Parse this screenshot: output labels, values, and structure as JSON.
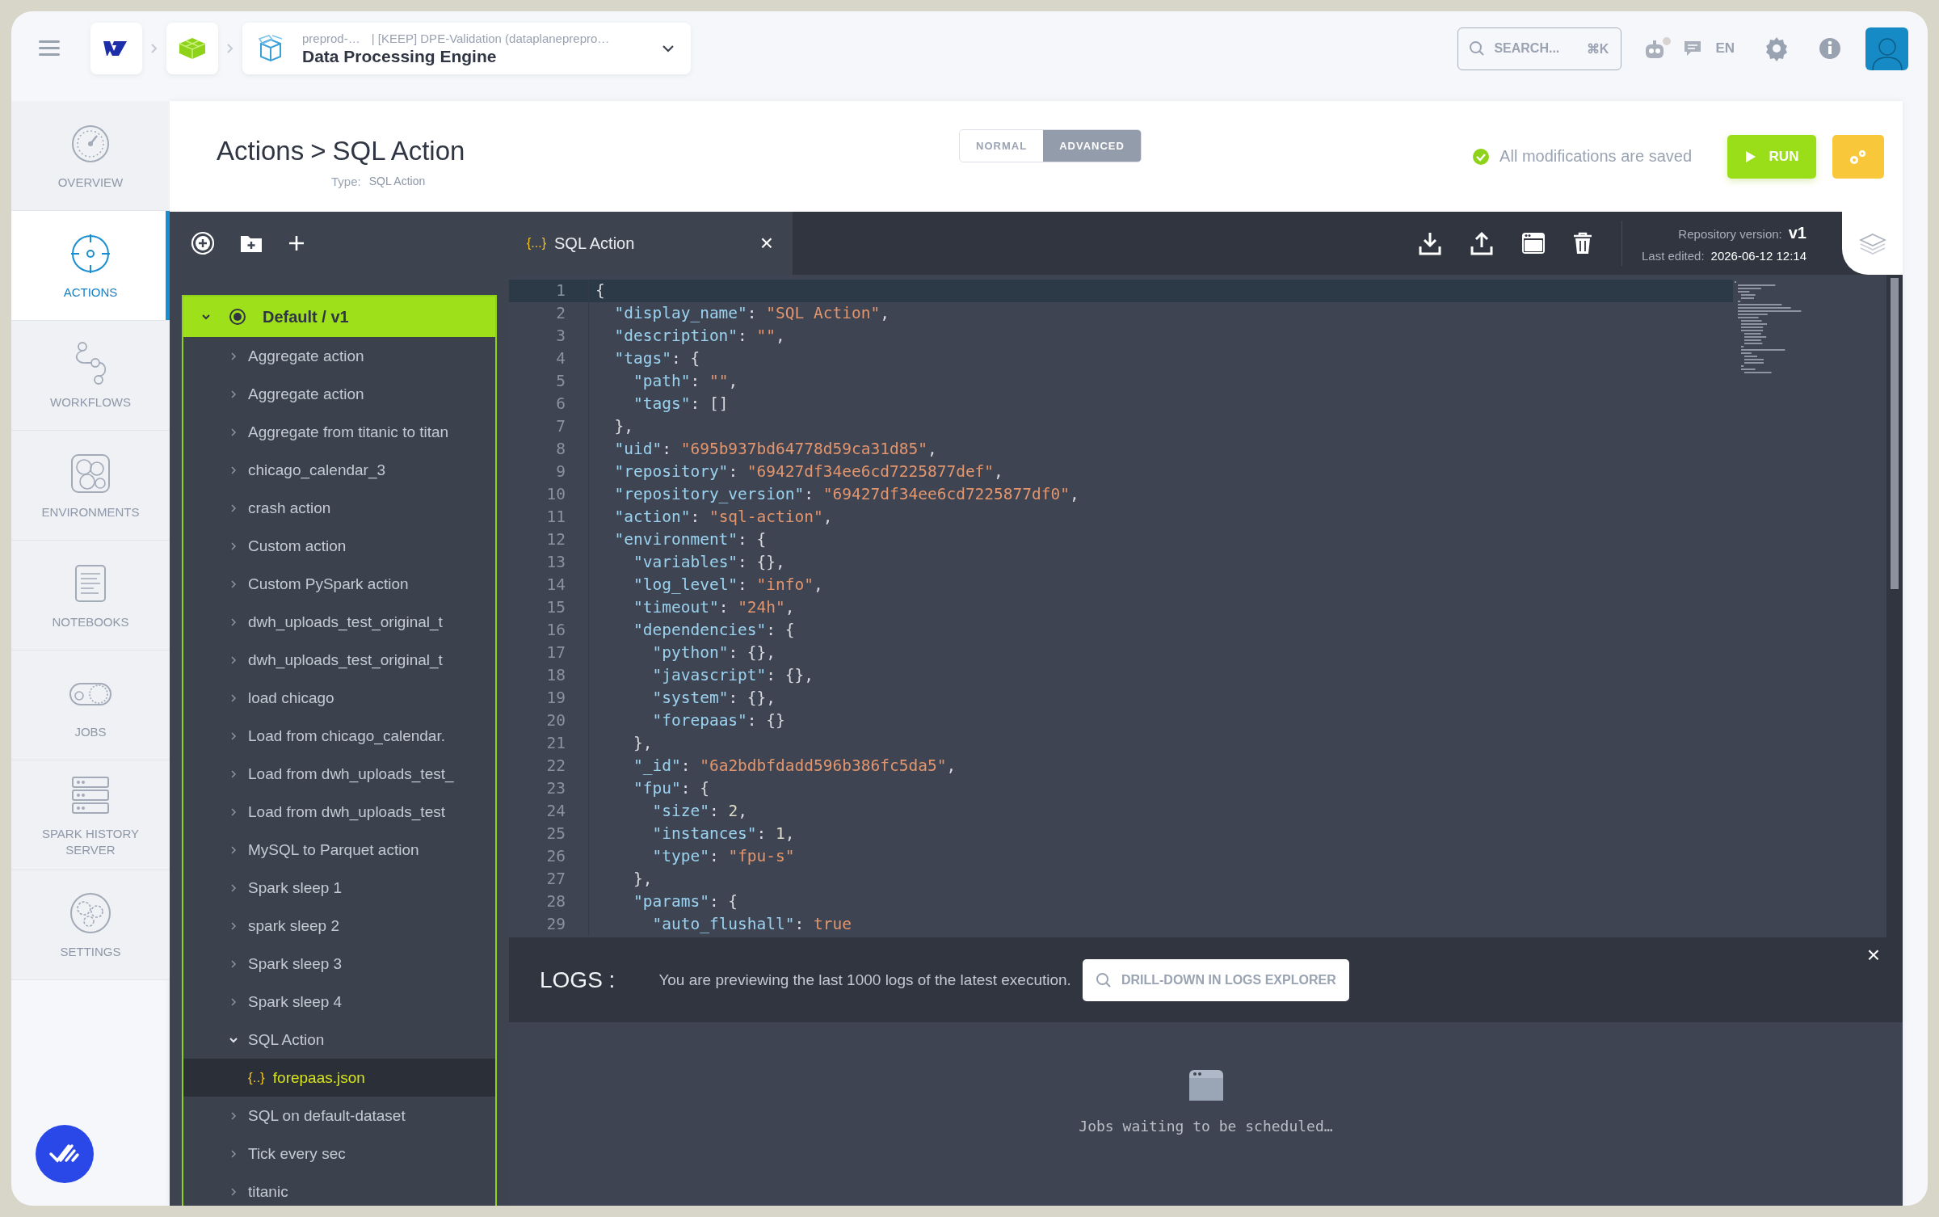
{
  "topbar": {
    "project": "preprod-…",
    "workspace": "| [KEEP] DPE-Validation (dataplanepreprо…",
    "title": "Data Processing Engine",
    "search": {
      "placeholder": "SEARCH...",
      "shortcut": "⌘K"
    },
    "language": "EN"
  },
  "nav": [
    {
      "label": "OVERVIEW",
      "selected": false
    },
    {
      "label": "ACTIONS",
      "selected": true
    },
    {
      "label": "WORKFLOWS",
      "selected": false
    },
    {
      "label": "ENVIRONMENTS",
      "selected": false
    },
    {
      "label": "NOTEBOOKS",
      "selected": false
    },
    {
      "label": "JOBS",
      "selected": false
    },
    {
      "label": "SPARK HISTORY SERVER",
      "selected": false
    },
    {
      "label": "SETTINGS",
      "selected": false
    }
  ],
  "page": {
    "section": "Actions",
    "separator": ">",
    "title": "SQL Action",
    "type_label": "Type:",
    "type_value": "SQL Action",
    "modes": [
      {
        "label": "NORMAL",
        "selected": false
      },
      {
        "label": "ADVANCED",
        "selected": true
      }
    ],
    "status": "All modifications are saved",
    "run_label": "RUN"
  },
  "tree": {
    "root": {
      "label": "Default / v1",
      "expanded": true,
      "children": [
        {
          "label": "Aggregate action",
          "expanded": false,
          "selected": false
        },
        {
          "label": "Aggregate action",
          "expanded": false,
          "selected": false
        },
        {
          "label": "Aggregate from titanic to titan",
          "expanded": false,
          "selected": false
        },
        {
          "label": "chicago_calendar_3",
          "expanded": false,
          "selected": false
        },
        {
          "label": "crash action",
          "expanded": false,
          "selected": false
        },
        {
          "label": "Custom action",
          "expanded": false,
          "selected": false
        },
        {
          "label": "Custom PySpark action",
          "expanded": false,
          "selected": false
        },
        {
          "label": "dwh_uploads_test_original_t",
          "expanded": false,
          "selected": false
        },
        {
          "label": "dwh_uploads_test_original_t",
          "expanded": false,
          "selected": false
        },
        {
          "label": "load chicago",
          "expanded": false,
          "selected": false
        },
        {
          "label": "Load from chicago_calendar.",
          "expanded": false,
          "selected": false
        },
        {
          "label": "Load from dwh_uploads_test_",
          "expanded": false,
          "selected": false
        },
        {
          "label": "Load from dwh_uploads_test",
          "expanded": false,
          "selected": false
        },
        {
          "label": "MySQL to Parquet action",
          "expanded": false,
          "selected": false
        },
        {
          "label": "Spark sleep 1",
          "expanded": false,
          "selected": false
        },
        {
          "label": "spark sleep 2",
          "expanded": false,
          "selected": false
        },
        {
          "label": "Spark sleep 3",
          "expanded": false,
          "selected": false
        },
        {
          "label": "Spark sleep 4",
          "expanded": false,
          "selected": false
        },
        {
          "label": "SQL Action",
          "expanded": true,
          "selected": false,
          "children": [
            {
              "icon": "{..}",
              "label": "forepaas.json",
              "selected": true
            }
          ]
        },
        {
          "label": "SQL on default-dataset",
          "expanded": false,
          "selected": false
        },
        {
          "label": "Tick every sec",
          "expanded": false,
          "selected": false
        },
        {
          "label": "titanic",
          "expanded": false,
          "selected": false
        }
      ]
    }
  },
  "editor": {
    "tab": {
      "icon": "{...}",
      "label": "SQL Action",
      "close": "×"
    },
    "repository_version_label": "Repository version:",
    "repository_version": "v1",
    "last_edited_label": "Last edited:",
    "last_edited": "2026-06-12 12:14",
    "lines": [
      {
        "number": "1",
        "code": "{"
      },
      {
        "number": "2",
        "code": "  \"display_name\": \"SQL Action\","
      },
      {
        "number": "3",
        "code": "  \"description\": \"\","
      },
      {
        "number": "4",
        "code": "  \"tags\": {"
      },
      {
        "number": "5",
        "code": "    \"path\": \"\","
      },
      {
        "number": "6",
        "code": "    \"tags\": []"
      },
      {
        "number": "7",
        "code": "  },"
      },
      {
        "number": "8",
        "code": "  \"uid\": \"695b937bd64778d59ca31d85\","
      },
      {
        "number": "9",
        "code": "  \"repository\": \"69427df34ee6cd7225877def\","
      },
      {
        "number": "10",
        "code": "  \"repository_version\": \"69427df34ee6cd7225877df0\","
      },
      {
        "number": "11",
        "code": "  \"action\": \"sql-action\","
      },
      {
        "number": "12",
        "code": "  \"environment\": {"
      },
      {
        "number": "13",
        "code": "    \"variables\": {},"
      },
      {
        "number": "14",
        "code": "    \"log_level\": \"info\","
      },
      {
        "number": "15",
        "code": "    \"timeout\": \"24h\","
      },
      {
        "number": "16",
        "code": "    \"dependencies\": {"
      },
      {
        "number": "17",
        "code": "      \"python\": {},"
      },
      {
        "number": "18",
        "code": "      \"javascript\": {},"
      },
      {
        "number": "19",
        "code": "      \"system\": {},"
      },
      {
        "number": "20",
        "code": "      \"forepaas\": {}"
      },
      {
        "number": "21",
        "code": "    },"
      },
      {
        "number": "22",
        "code": "    \"_id\": \"6a2bdbfdadd596b386fc5da5\","
      },
      {
        "number": "23",
        "code": "    \"fpu\": {"
      },
      {
        "number": "24",
        "code": "      \"size\": 2,"
      },
      {
        "number": "25",
        "code": "      \"instances\": 1,"
      },
      {
        "number": "26",
        "code": "      \"type\": \"fpu-s\""
      },
      {
        "number": "27",
        "code": "    },"
      },
      {
        "number": "28",
        "code": "    \"params\": {"
      },
      {
        "number": "29",
        "code": "      \"auto_flushall\": true"
      }
    ]
  },
  "logs": {
    "title": "LOGS :",
    "message": "You are previewing the last 1000 logs of the latest execution.",
    "button": "DRILL-DOWN IN LOGS EXPLORER",
    "close": "×",
    "empty": "Jobs waiting to be scheduled…"
  }
}
